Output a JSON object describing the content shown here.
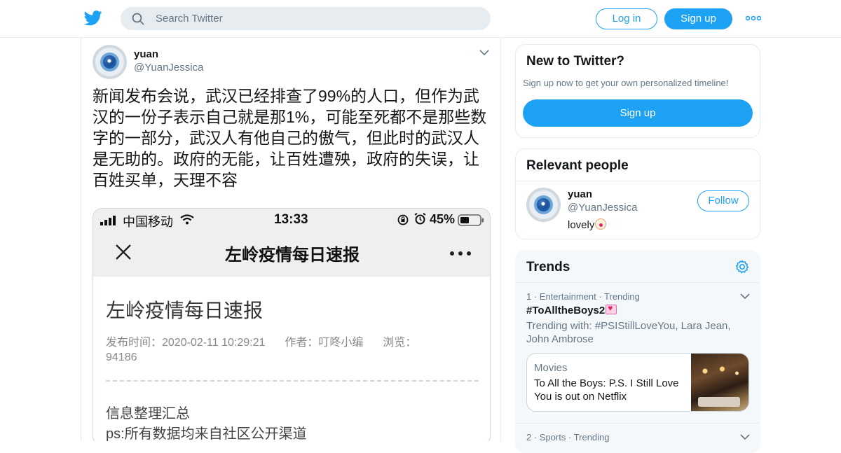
{
  "header": {
    "search_placeholder": "Search Twitter",
    "login_label": "Log in",
    "signup_label": "Sign up",
    "brand_color": "#1da1f2"
  },
  "tweet": {
    "name": "yuan",
    "handle": "@YuanJessica",
    "text": "新闻发布会说，武汉已经排查了99%的人口，但作为武汉的一份子表示自己就是那1%，可能至死都不是那些数字的一部分，武汉人有他自己的傲气，但此时的武汉人是无助的。政府的无能，让百姓遭殃，政府的失误，让百姓买单，天理不容",
    "media": {
      "carrier": "中国移动",
      "time": "13:33",
      "battery": "45%",
      "nav_title": "左岭疫情每日速报",
      "article_title": "左岭疫情每日速报",
      "publish_label": "发布时间：2020-02-11 10:29:21",
      "author_label": "作者：叮咚小编",
      "views_label": "浏览：",
      "views_value": "94186",
      "section_heading": "信息整理汇总",
      "ps_line": "ps:所有数据均来自社区公开渠道"
    }
  },
  "new_to_twitter": {
    "title": "New to Twitter?",
    "subtitle": "Sign up now to get your own personalized timeline!",
    "button": "Sign up"
  },
  "relevant_people": {
    "title": "Relevant people",
    "name": "yuan",
    "handle": "@YuanJessica",
    "bio": "lovely",
    "follow_label": "Follow"
  },
  "trends": {
    "title": "Trends",
    "items": [
      {
        "meta": "1 · Entertainment · Trending",
        "tag": "#ToAlltheBoys2",
        "with": "Trending with: #PSIStillLoveYou, Lara Jean, John Ambrose",
        "card_category": "Movies",
        "card_text": "To All the Boys: P.S. I Still Love You is out on Netflix"
      },
      {
        "meta": "2 · Sports · Trending"
      }
    ]
  }
}
